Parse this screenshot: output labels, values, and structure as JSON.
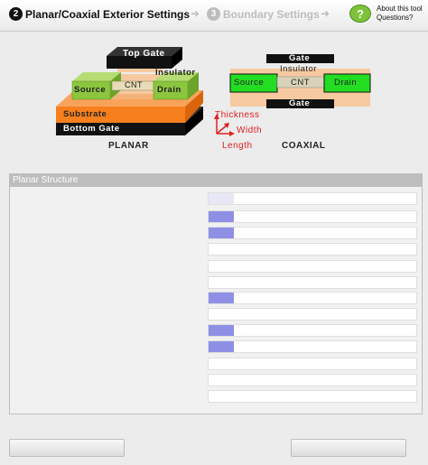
{
  "header": {
    "steps": [
      {
        "number": "2",
        "label": "Planar/Coaxial Exterior Settings"
      },
      {
        "number": "3",
        "label": "Boundary Settings"
      }
    ],
    "arrow1": "➜",
    "arrow2": "➜",
    "help_glyph": "?",
    "help_text_line1": "About this tool",
    "help_text_line2": "Questions?"
  },
  "figure": {
    "planar": {
      "top_gate": "Top Gate",
      "insulator": "Insulator",
      "source": "Source",
      "cnt": "CNT",
      "drain": "Drain",
      "substrate": "Substrate",
      "bottom_gate": "Bottom Gate",
      "caption": "PLANAR"
    },
    "axes": {
      "thickness": "Thickness",
      "width": "Width",
      "length": "Length"
    },
    "coaxial": {
      "gate_top": "Gate",
      "insulator": "Insulator",
      "source": "Source",
      "cnt": "CNT",
      "drain": "Drain",
      "gate_bottom": "Gate",
      "caption": "COAXIAL"
    },
    "colors": {
      "orange": "#f77f1e",
      "green": "#8cc63f",
      "bright_green": "#22dd22",
      "gate_black": "#111111",
      "insulator": "#f6c9a0",
      "axis_red": "#e02020"
    }
  },
  "panel": {
    "title": "Planar Structure",
    "fields": [
      {
        "fill": 0.12,
        "style": "pale"
      },
      {
        "fill": 0.12,
        "style": "solid"
      },
      {
        "fill": 0.12,
        "style": "solid"
      },
      {
        "fill": 0.0,
        "style": "none"
      },
      {
        "fill": 0.0,
        "style": "none"
      },
      {
        "fill": 0.0,
        "style": "none"
      },
      {
        "fill": 0.12,
        "style": "solid"
      },
      {
        "fill": 0.0,
        "style": "none"
      },
      {
        "fill": 0.12,
        "style": "solid"
      },
      {
        "fill": 0.12,
        "style": "solid"
      },
      {
        "fill": 0.0,
        "style": "none"
      },
      {
        "fill": 0.0,
        "style": "none"
      },
      {
        "fill": 0.0,
        "style": "none"
      }
    ]
  }
}
